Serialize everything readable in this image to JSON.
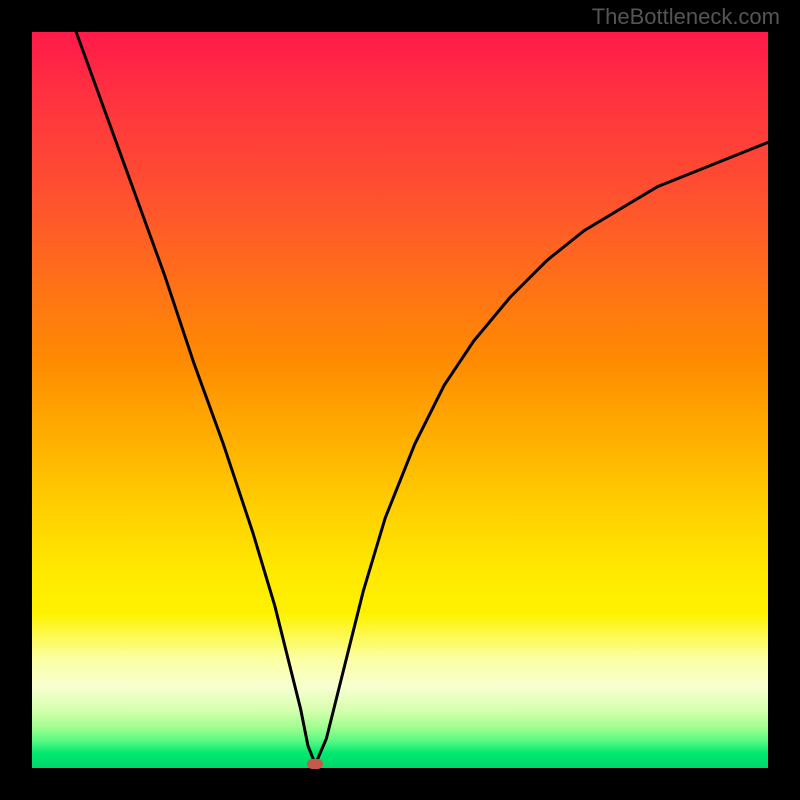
{
  "watermark": "TheBottleneck.com",
  "chart_data": {
    "type": "line",
    "title": "",
    "xlabel": "",
    "ylabel": "",
    "xlim": [
      0,
      100
    ],
    "ylim": [
      0,
      100
    ],
    "x": [
      6,
      10,
      14,
      18,
      22,
      26,
      30,
      33,
      35,
      36.5,
      37.5,
      38.5,
      40,
      42,
      45,
      48,
      52,
      56,
      60,
      65,
      70,
      75,
      80,
      85,
      90,
      95,
      100
    ],
    "y": [
      100,
      89,
      78,
      67,
      55,
      44,
      32,
      22,
      14,
      8,
      3,
      0.5,
      4,
      12,
      24,
      34,
      44,
      52,
      58,
      64,
      69,
      73,
      76,
      79,
      81,
      83,
      85
    ],
    "minimum_point": {
      "x": 38.5,
      "y": 0.5
    },
    "colors": {
      "curve": "#000000",
      "dot": "#c45a4a",
      "gradient_top": "#ff1a4a",
      "gradient_mid": "#ffd000",
      "gradient_bottom": "#00d868"
    }
  }
}
